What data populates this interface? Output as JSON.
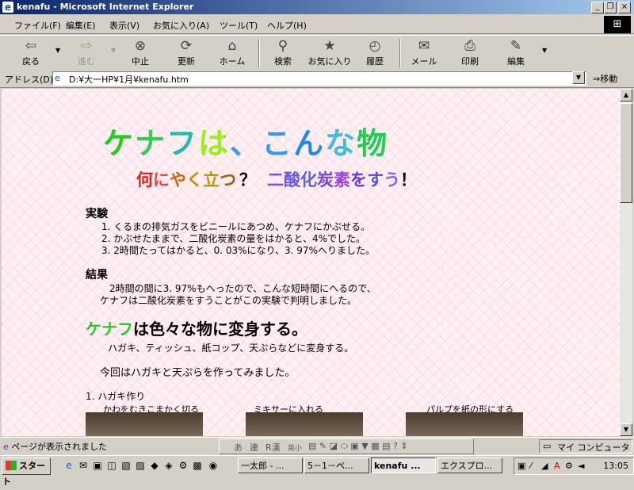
{
  "window": {
    "title": "kenafu - Microsoft Internet Explorer"
  },
  "menu": [
    "ファイル(F)",
    "編集(E)",
    "表示(V)",
    "お気に入り(A)",
    "ツール(T)",
    "ヘルプ(H)"
  ],
  "toolbar": {
    "back": "戻る",
    "forward": "進む",
    "stop": "中止",
    "refresh": "更新",
    "home": "ホーム",
    "search": "検索",
    "favorites": "お気に入り",
    "history": "履歴",
    "mail": "メール",
    "print": "印刷",
    "edit": "編集"
  },
  "address": {
    "label": "アドレス(D)",
    "value": "D:¥大一HP¥1月¥kenafu.htm",
    "go": "移動"
  },
  "page": {
    "heading": "ケナフは、こんな物",
    "subheading_part1": "何にやく立つ",
    "subheading_q": "？",
    "subheading_part2": "二酸化炭素をすう",
    "subheading_excl": "！",
    "experiment_title": "実験",
    "experiment_steps": [
      "1. くるまの排気ガスをビニールにあつめ、ケナフにかぶせる。",
      "2. かぶせたままで、二酸化炭素の量をはかると、4%でした。",
      "3. 2時間たってはかると、0. 03%になり、3. 97%へりました。"
    ],
    "result_title": "結果",
    "result_lines": [
      "2時間の間に3. 97%もへったので、こんな短時間にへるので、",
      "ケナフは二酸化炭素をすうことがこの実験で判明しました。"
    ],
    "kenafu_word": "ケナフ",
    "kenafu_rest": "は色々な物に変身する。",
    "transform_line": "ハガキ、ティッシュ、紙コップ、天ぷらなどに変身する。",
    "this_time_line": "今回はハガキと天ぷらを作ってみました。",
    "postcard_title": "1. ハガキ作り",
    "captions": [
      "かわをむきこまかく切る",
      "ミキサーに入れる",
      "パルプを紙の形にする"
    ]
  },
  "status": {
    "text": "ページが表示されました",
    "zone": "マイ コンピュータ"
  },
  "ime": [
    "あ",
    "連",
    "R漢",
    "英小"
  ],
  "taskbar": {
    "start": "スタート",
    "tasks": [
      "一太郎 - ...",
      "5－1－ペ...",
      "kenafu ...",
      "エクスプロ..."
    ],
    "clock": "13:05"
  },
  "colors": {
    "title_start": "#0a246a",
    "title_end": "#a6caf0"
  }
}
